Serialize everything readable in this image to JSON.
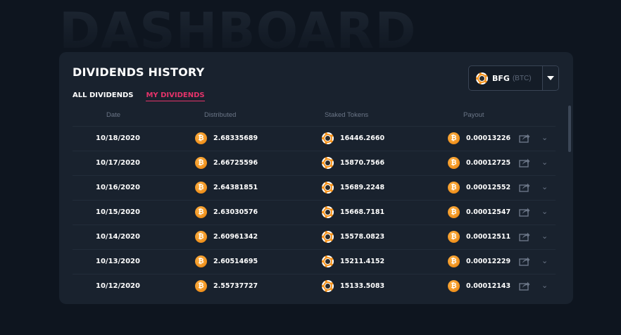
{
  "page": {
    "background_title": "DASHBOARD"
  },
  "card": {
    "title": "DIVIDENDS HISTORY",
    "tabs": [
      {
        "label": "ALL DIVIDENDS",
        "active": true
      },
      {
        "label": "MY DIVIDENDS",
        "active": false
      }
    ],
    "selector": {
      "symbol": "BFG",
      "sub": "(BTC)",
      "icon": "bfg-chip-icon"
    },
    "columns": [
      "Date",
      "Distributed",
      "Staked Tokens",
      "Payout"
    ],
    "rows": [
      {
        "date": "10/18/2020",
        "distributed": "2.68335689",
        "staked": "16446.2660",
        "payout": "0.00013226"
      },
      {
        "date": "10/17/2020",
        "distributed": "2.66725596",
        "staked": "15870.7566",
        "payout": "0.00012725"
      },
      {
        "date": "10/16/2020",
        "distributed": "2.64381851",
        "staked": "15689.2248",
        "payout": "0.00012552"
      },
      {
        "date": "10/15/2020",
        "distributed": "2.63030576",
        "staked": "15668.7181",
        "payout": "0.00012547"
      },
      {
        "date": "10/14/2020",
        "distributed": "2.60961342",
        "staked": "15578.0823",
        "payout": "0.00012511"
      },
      {
        "date": "10/13/2020",
        "distributed": "2.60514695",
        "staked": "15211.4152",
        "payout": "0.00012229"
      },
      {
        "date": "10/12/2020",
        "distributed": "2.55737727",
        "staked": "15133.5083",
        "payout": "0.00012143"
      }
    ]
  },
  "colors": {
    "accent": "#e5336a",
    "btc": "#f7941d",
    "background": "#0e151f",
    "card": "#19222e"
  },
  "icons": {
    "currency": "btc-icon",
    "token": "bfg-chip-icon",
    "share": "share-icon",
    "expand": "chevron-down-icon"
  }
}
